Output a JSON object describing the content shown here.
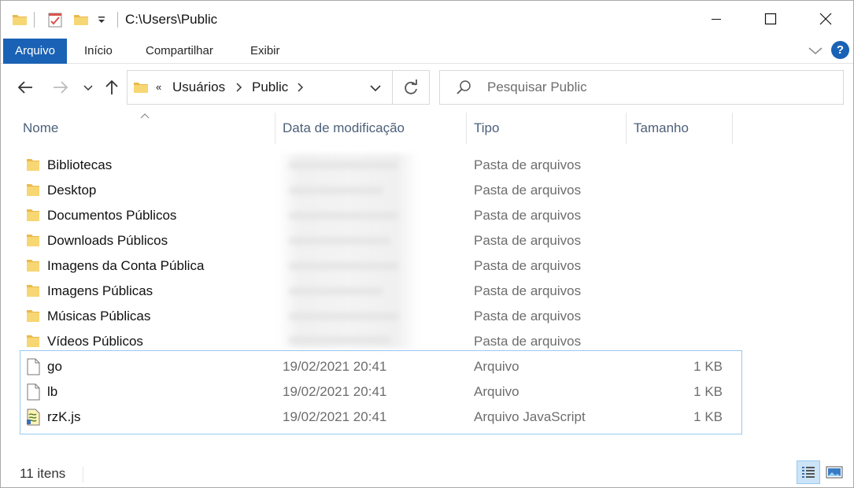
{
  "window": {
    "title": "C:\\Users\\Public",
    "controls": {
      "minimize": "minimize",
      "maximize": "maximize",
      "close": "close"
    }
  },
  "ribbon": {
    "tabs": [
      {
        "label": "Arquivo",
        "active": true
      },
      {
        "label": "Início"
      },
      {
        "label": "Compartilhar"
      },
      {
        "label": "Exibir"
      }
    ],
    "help_label": "?",
    "accent_color": "#1a62b5"
  },
  "address": {
    "overflow": "«",
    "crumbs": [
      "Usuários",
      "Public"
    ]
  },
  "search": {
    "placeholder": "Pesquisar Public",
    "value": ""
  },
  "columns": {
    "name": "Nome",
    "date": "Data de modificação",
    "type": "Tipo",
    "size": "Tamanho",
    "sort_column": "name",
    "sort_direction": "ascending"
  },
  "rows": [
    {
      "name": "Bibliotecas",
      "date": "",
      "type": "Pasta de arquivos",
      "size": "",
      "icon": "folder-icon"
    },
    {
      "name": "Desktop",
      "date": "",
      "type": "Pasta de arquivos",
      "size": "",
      "icon": "folder-icon"
    },
    {
      "name": "Documentos Públicos",
      "date": "",
      "type": "Pasta de arquivos",
      "size": "",
      "icon": "folder-icon"
    },
    {
      "name": "Downloads Públicos",
      "date": "",
      "type": "Pasta de arquivos",
      "size": "",
      "icon": "folder-icon"
    },
    {
      "name": "Imagens da Conta Pública",
      "date": "",
      "type": "Pasta de arquivos",
      "size": "",
      "icon": "folder-icon"
    },
    {
      "name": "Imagens Públicas",
      "date": "",
      "type": "Pasta de arquivos",
      "size": "",
      "icon": "folder-icon"
    },
    {
      "name": "Músicas Públicas",
      "date": "",
      "type": "Pasta de arquivos",
      "size": "",
      "icon": "folder-icon"
    },
    {
      "name": "Vídeos Públicos",
      "date": "",
      "type": "Pasta de arquivos",
      "size": "",
      "icon": "folder-icon"
    },
    {
      "name": "go",
      "date": "19/02/2021 20:41",
      "type": "Arquivo",
      "size": "1 KB",
      "icon": "file-icon"
    },
    {
      "name": "lb",
      "date": "19/02/2021 20:41",
      "type": "Arquivo",
      "size": "1 KB",
      "icon": "file-icon"
    },
    {
      "name": "rzK.js",
      "date": "19/02/2021 20:41",
      "type": "Arquivo JavaScript",
      "size": "1 KB",
      "icon": "script-file-icon"
    }
  ],
  "status": {
    "item_count": "11 itens"
  },
  "views": {
    "details_active": true
  }
}
